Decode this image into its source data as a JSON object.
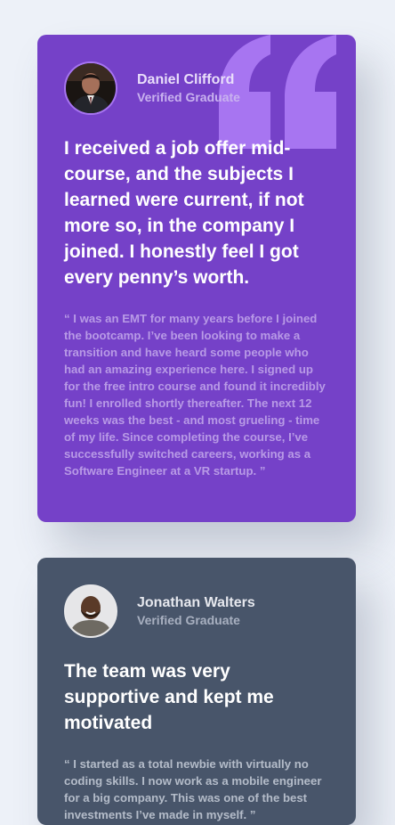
{
  "colors": {
    "page_background": "#edf1f8",
    "card_purple": "#7541c8",
    "card_slate": "#48556a",
    "quote_mark": "#a775f1"
  },
  "testimonials": [
    {
      "name": "Daniel Clifford",
      "role": "Verified Graduate",
      "title": "I received a job offer mid-course, and the subjects I learned were current, if not more so, in the company I joined. I honestly feel I got every penny’s worth.",
      "body": "“ I was an EMT for many years before I joined the bootcamp. I’ve been looking to make a transition and have heard some people who had an amazing experience here. I signed up for the free intro course and found it incredibly fun! I enrolled shortly thereafter. The next 12 weeks was the best - and most grueling - time of my life. Since completing the course, I’ve successfully switched careers, working as a Software Engineer at a VR startup. ”"
    },
    {
      "name": "Jonathan Walters",
      "role": "Verified Graduate",
      "title": "The team was very supportive and kept me motivated",
      "body": "“ I started as a total newbie with virtually no coding skills. I now work as a mobile engineer for a big company. This was one of the best investments I’ve made in myself. ”"
    }
  ]
}
